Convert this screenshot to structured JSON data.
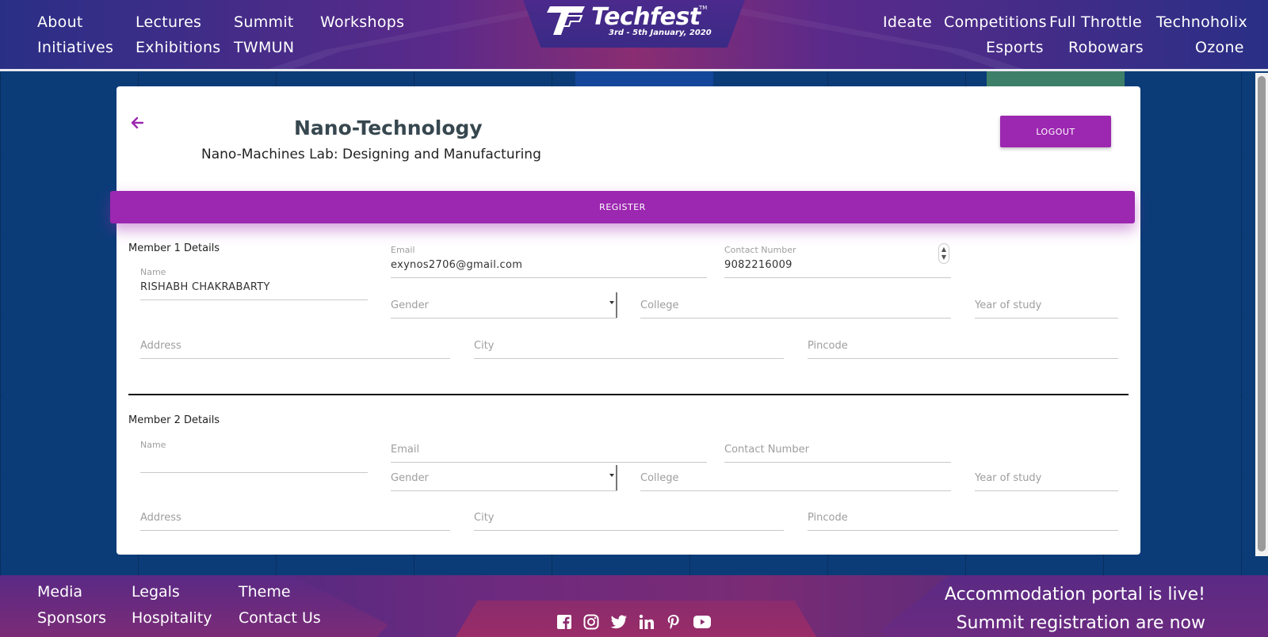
{
  "header": {
    "nav_left_row1": [
      "About",
      "Lectures",
      "Summit",
      "Workshops"
    ],
    "nav_left_row2": [
      "Initiatives",
      "Exhibitions",
      "TWMUN"
    ],
    "nav_right_row1": [
      "Ideate",
      "Competitions",
      "Full Throttle",
      "Technoholix"
    ],
    "nav_right_row2": [
      "Esports",
      "Robowars",
      "Ozone"
    ],
    "logo": {
      "brand": "Techfest",
      "dates": "3rd - 5th January, 2020",
      "tm": "TM"
    }
  },
  "event": {
    "title": "Nano-Technology",
    "subtitle": "Nano-Machines Lab: Designing and Manufacturing",
    "logout_label": "LOGOUT",
    "register_label": "REGISTER"
  },
  "members": [
    {
      "heading": "Member 1 Details",
      "name_label": "Name",
      "name_value": "RISHABH CHAKRABARTY",
      "email_label": "Email",
      "email_value": "exynos2706@gmail.com",
      "contact_label": "Contact Number",
      "contact_value": "9082216009",
      "gender_placeholder": "Gender",
      "college_placeholder": "College",
      "year_placeholder": "Year of study",
      "address_placeholder": "Address",
      "city_placeholder": "City",
      "pincode_placeholder": "Pincode"
    },
    {
      "heading": "Member 2 Details",
      "name_label": "Name",
      "name_value": "",
      "email_placeholder": "Email",
      "contact_placeholder": "Contact Number",
      "gender_placeholder": "Gender",
      "college_placeholder": "College",
      "year_placeholder": "Year of study",
      "address_placeholder": "Address",
      "city_placeholder": "City",
      "pincode_placeholder": "Pincode"
    }
  ],
  "footer": {
    "links_row1": [
      "Media",
      "Legals",
      "Theme"
    ],
    "links_row2": [
      "Sponsors",
      "Hospitality",
      "Contact Us"
    ],
    "announcement_line1": "Accommodation portal is live!",
    "announcement_line2": "Summit registration are now",
    "social_icons": [
      "facebook-icon",
      "instagram-icon",
      "twitter-icon",
      "linkedin-icon",
      "pinterest-icon",
      "youtube-icon"
    ]
  },
  "colors": {
    "accent": "#9c27b0",
    "background": "#0b3c78",
    "header": "#5b2a8a"
  }
}
